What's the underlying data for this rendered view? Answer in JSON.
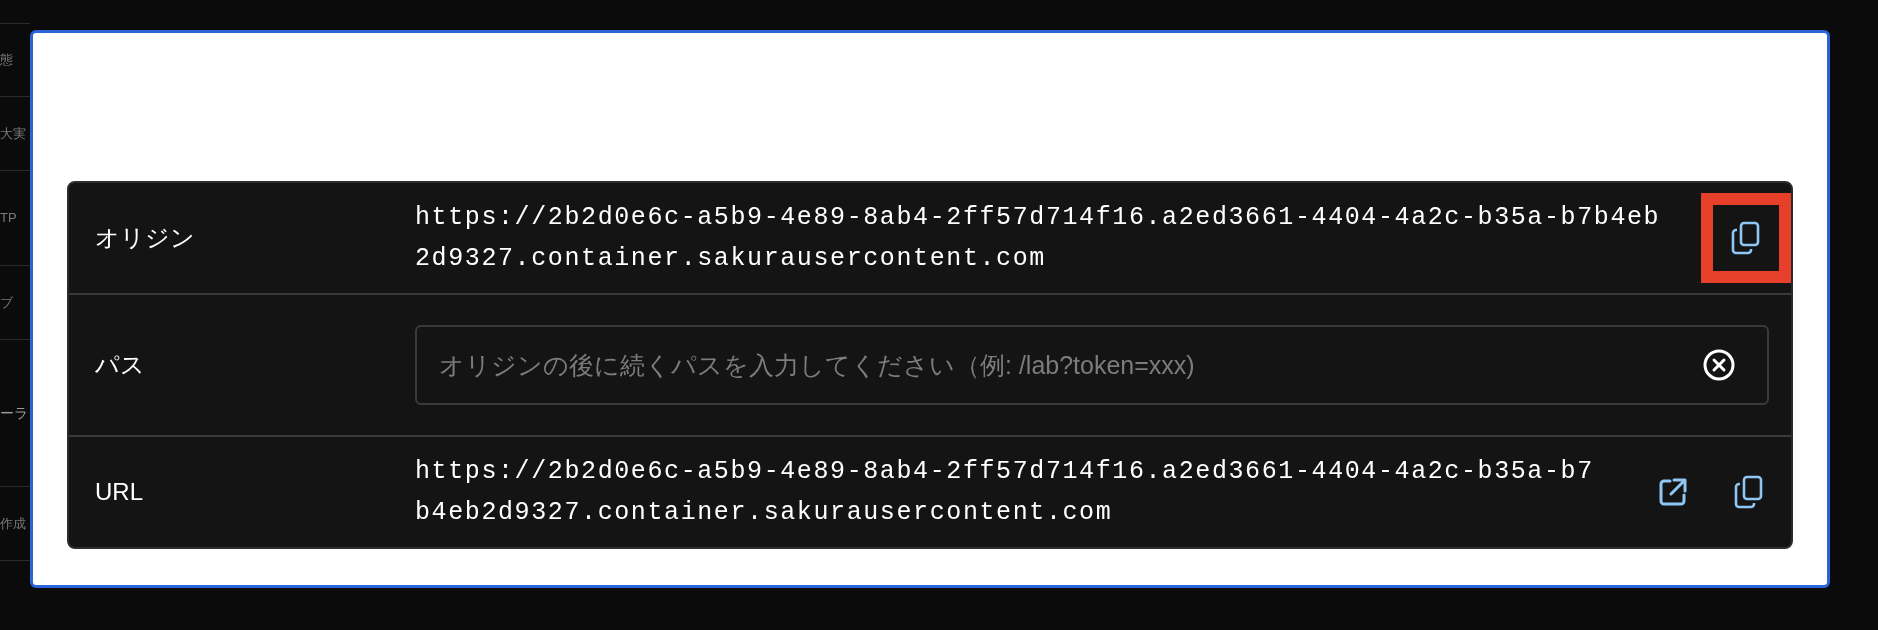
{
  "background_items": [
    {
      "text": "態",
      "kind": "row"
    },
    {
      "text": "大実",
      "kind": "row"
    },
    {
      "text": "TP",
      "kind": "row"
    },
    {
      "text": "ブ",
      "kind": "row"
    },
    {
      "text": "ーラ",
      "kind": "heading"
    },
    {
      "text": "作成",
      "kind": "row"
    }
  ],
  "dialog": {
    "rows": [
      {
        "kind": "text",
        "label": "オリジン",
        "value": "https://2b2d0e6c-a5b9-4e89-8ab4-2ff57d714f16.a2ed3661-4404-4a2c-b35a-b7b4eb2d9327.container.sakurausercontent.com",
        "actions": [
          {
            "kind": "copy",
            "highlighted": true
          }
        ]
      },
      {
        "kind": "input",
        "label": "パス",
        "placeholder": "オリジンの後に続くパスを入力してください（例: /lab?token=xxx)",
        "actions": [
          {
            "kind": "clear",
            "highlighted": false
          }
        ]
      },
      {
        "kind": "text",
        "label": "URL",
        "value": "https://2b2d0e6c-a5b9-4e89-8ab4-2ff57d714f16.a2ed3661-4404-4a2c-b35a-b7b4eb2d9327.container.sakurausercontent.com",
        "actions": [
          {
            "kind": "open",
            "highlighted": false
          },
          {
            "kind": "copy",
            "highlighted": false
          }
        ]
      }
    ]
  }
}
